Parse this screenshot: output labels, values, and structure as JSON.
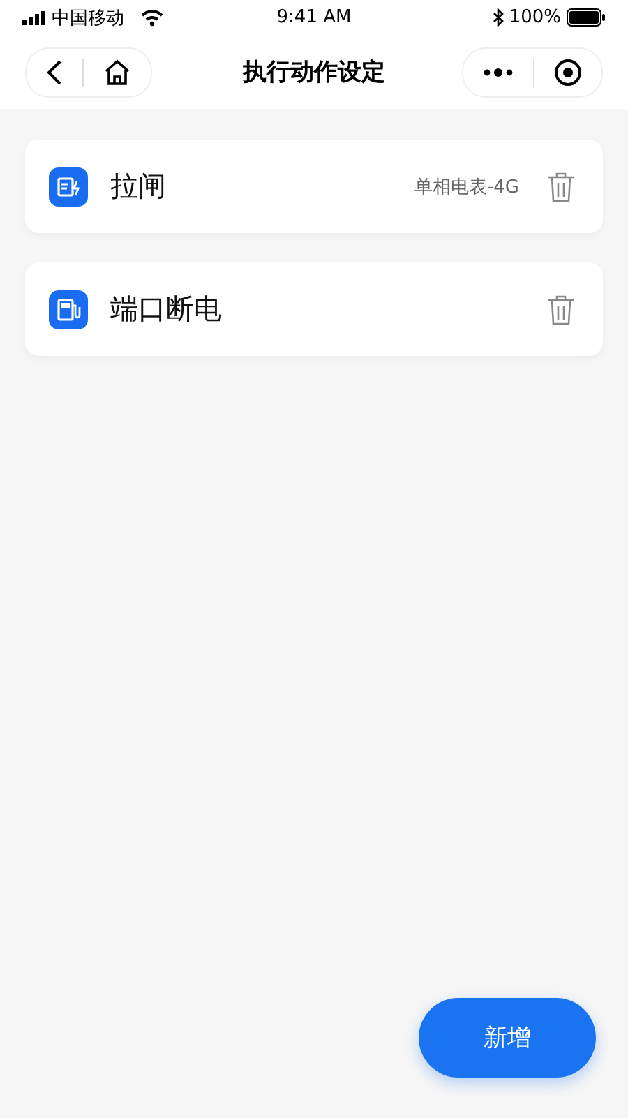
{
  "status_bar": {
    "carrier": "中国移动",
    "time": "9:41 AM",
    "battery": "100%"
  },
  "nav": {
    "title": "执行动作设定"
  },
  "actions": [
    {
      "kind": "switch",
      "name": "拉闸",
      "device": "单相电表-4G"
    },
    {
      "kind": "port",
      "name": "端口断电"
    }
  ],
  "add_button": "新增"
}
